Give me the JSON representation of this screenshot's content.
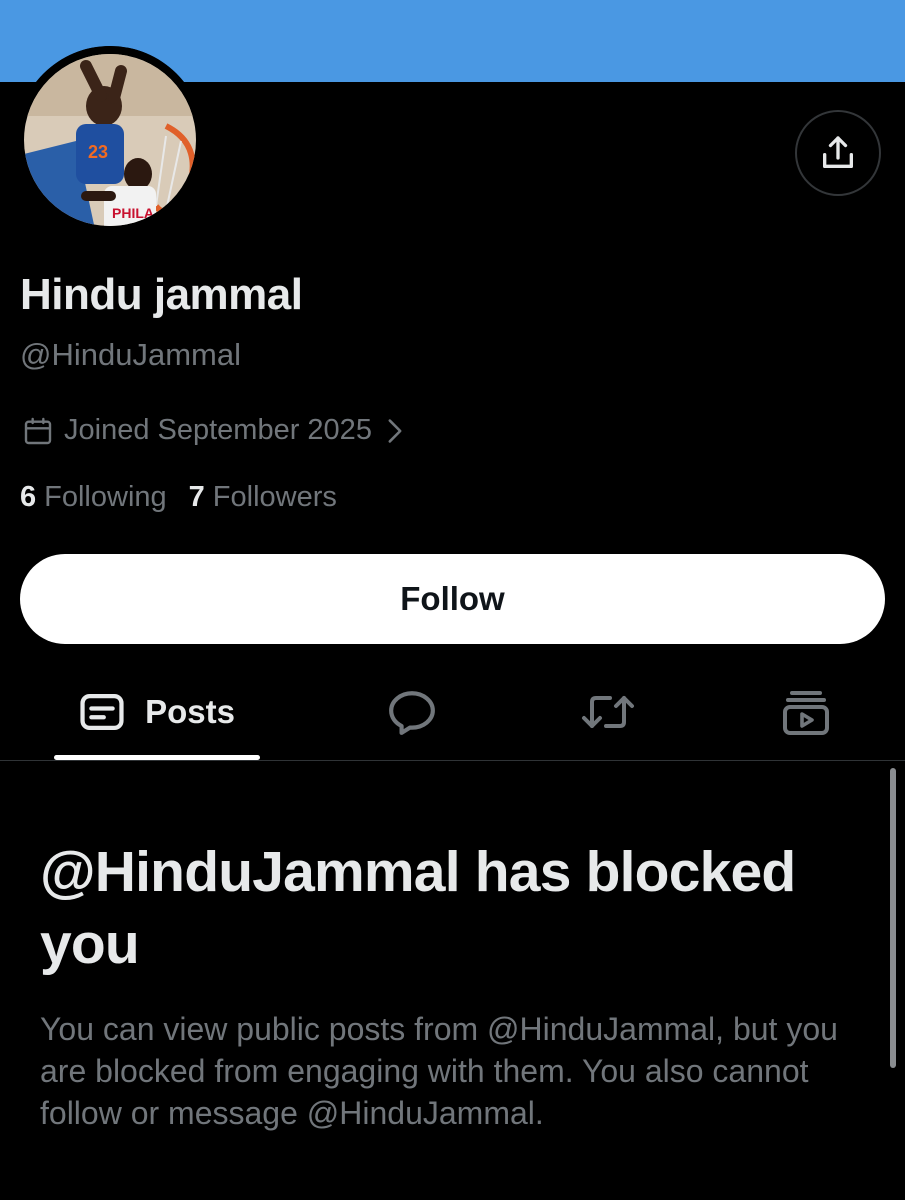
{
  "profile": {
    "display_name": "Hindu jammal",
    "handle": "@HinduJammal",
    "joined": "Joined September 2025",
    "following_count": "6",
    "following_label": "Following",
    "followers_count": "7",
    "followers_label": "Followers"
  },
  "actions": {
    "follow_label": "Follow",
    "share_icon": "share-icon"
  },
  "tabs": [
    {
      "label": "Posts",
      "icon": "posts-icon",
      "active": true
    },
    {
      "label": "",
      "icon": "replies-icon",
      "active": false
    },
    {
      "label": "",
      "icon": "reposts-icon",
      "active": false
    },
    {
      "label": "",
      "icon": "media-icon",
      "active": false
    }
  ],
  "blocked_notice": {
    "title": "@HinduJammal has blocked you",
    "description": "You can view public posts from @HinduJammal, but you are blocked from engaging with them. You also cannot follow or message @HinduJammal."
  },
  "colors": {
    "banner": "#4a98e3",
    "background": "#000000",
    "primary_text": "#e7e9ea",
    "secondary_text": "#71767b",
    "follow_button": "#ffffff"
  }
}
